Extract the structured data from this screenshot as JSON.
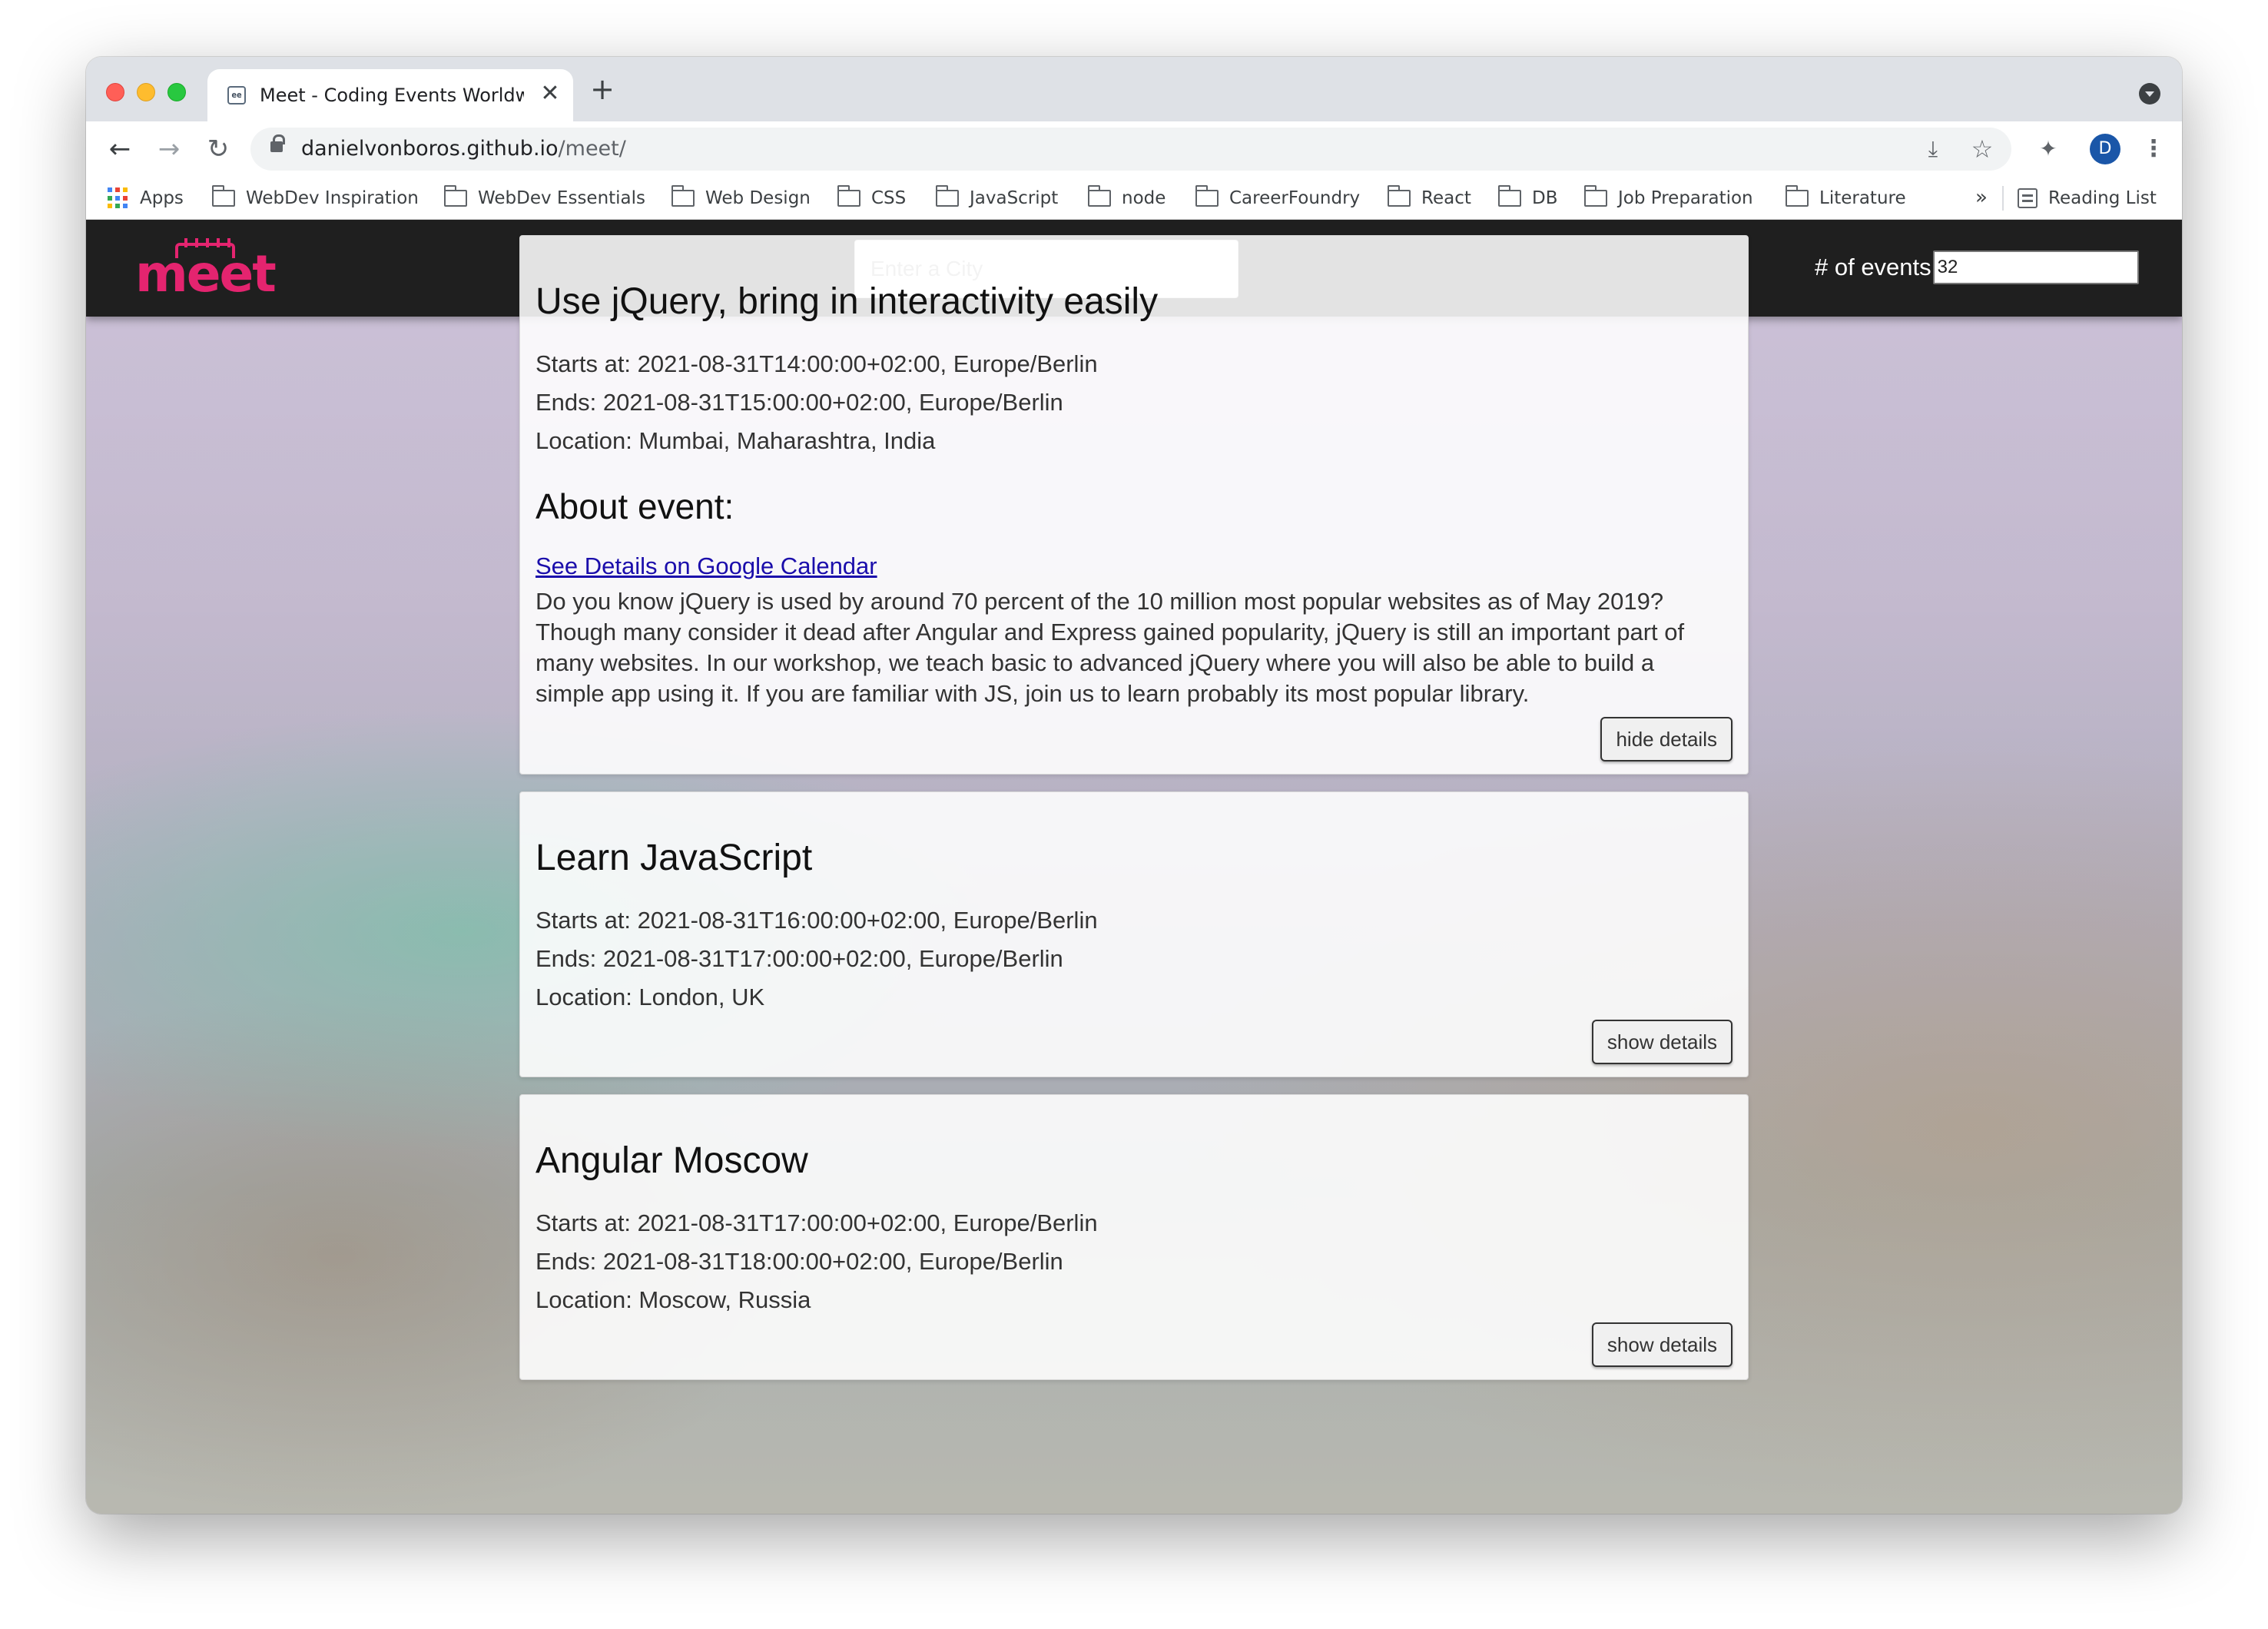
{
  "browser": {
    "tab": {
      "favicon": "ee",
      "title": "Meet - Coding Events Worldwide",
      "close": "✕"
    },
    "new_tab": "+",
    "nav": {
      "back": "←",
      "forward": "→",
      "reload": "↻"
    },
    "url": {
      "host": "danielvonboros.github.io",
      "path": "/meet/"
    },
    "profile_initial": "D",
    "icons": {
      "lock": "lock-icon",
      "install": "install-icon",
      "star": "star-icon",
      "extensions": "puzzle-icon",
      "menu": "kebab-menu-icon"
    },
    "bookmarks": [
      {
        "label": "Apps",
        "icon": "apps-grid-icon"
      },
      {
        "label": "WebDev Inspiration",
        "icon": "folder-icon"
      },
      {
        "label": "WebDev Essentials",
        "icon": "folder-icon"
      },
      {
        "label": "Web Design",
        "icon": "folder-icon"
      },
      {
        "label": "CSS",
        "icon": "folder-icon"
      },
      {
        "label": "JavaScript",
        "icon": "folder-icon"
      },
      {
        "label": "node",
        "icon": "folder-icon"
      },
      {
        "label": "CareerFoundry",
        "icon": "folder-icon"
      },
      {
        "label": "React",
        "icon": "folder-icon"
      },
      {
        "label": "DB",
        "icon": "folder-icon"
      },
      {
        "label": "Job Preparation",
        "icon": "folder-icon"
      },
      {
        "label": "Literature",
        "icon": "folder-icon"
      }
    ],
    "bookmarks_more": "»",
    "reading_list": "Reading List"
  },
  "app": {
    "logo_text": "meet",
    "brand_color": "#e4246f",
    "city_search": {
      "placeholder": "Enter a City",
      "value": ""
    },
    "number_of_events": {
      "label": "# of events",
      "value": "32"
    }
  },
  "events": [
    {
      "title": "Use jQuery, bring in interactivity easily",
      "starts": "Starts at: 2021-08-31T14:00:00+02:00, Europe/Berlin",
      "ends": "Ends: 2021-08-31T15:00:00+02:00, Europe/Berlin",
      "location": "Location: Mumbai, Maharashtra, India",
      "expanded": true,
      "about_title": "About event:",
      "calendar_link": "See Details on Google Calendar",
      "description": "Do you know jQuery is used by around 70 percent of the 10 million most popular websites as of May 2019? Though many consider it dead after Angular and Express gained popularity, jQuery is still an important part of many websites. In our workshop, we teach basic to advanced jQuery where you will also be able to build a simple app using it. If you are familiar with JS, join us to learn probably its most popular library.",
      "button": "hide details"
    },
    {
      "title": "Learn JavaScript",
      "starts": "Starts at: 2021-08-31T16:00:00+02:00, Europe/Berlin",
      "ends": "Ends: 2021-08-31T17:00:00+02:00, Europe/Berlin",
      "location": "Location: London, UK",
      "expanded": false,
      "button": "show details"
    },
    {
      "title": "Angular Moscow",
      "starts": "Starts at: 2021-08-31T17:00:00+02:00, Europe/Berlin",
      "ends": "Ends: 2021-08-31T18:00:00+02:00, Europe/Berlin",
      "location": "Location: Moscow, Russia",
      "expanded": false,
      "button": "show details"
    }
  ]
}
